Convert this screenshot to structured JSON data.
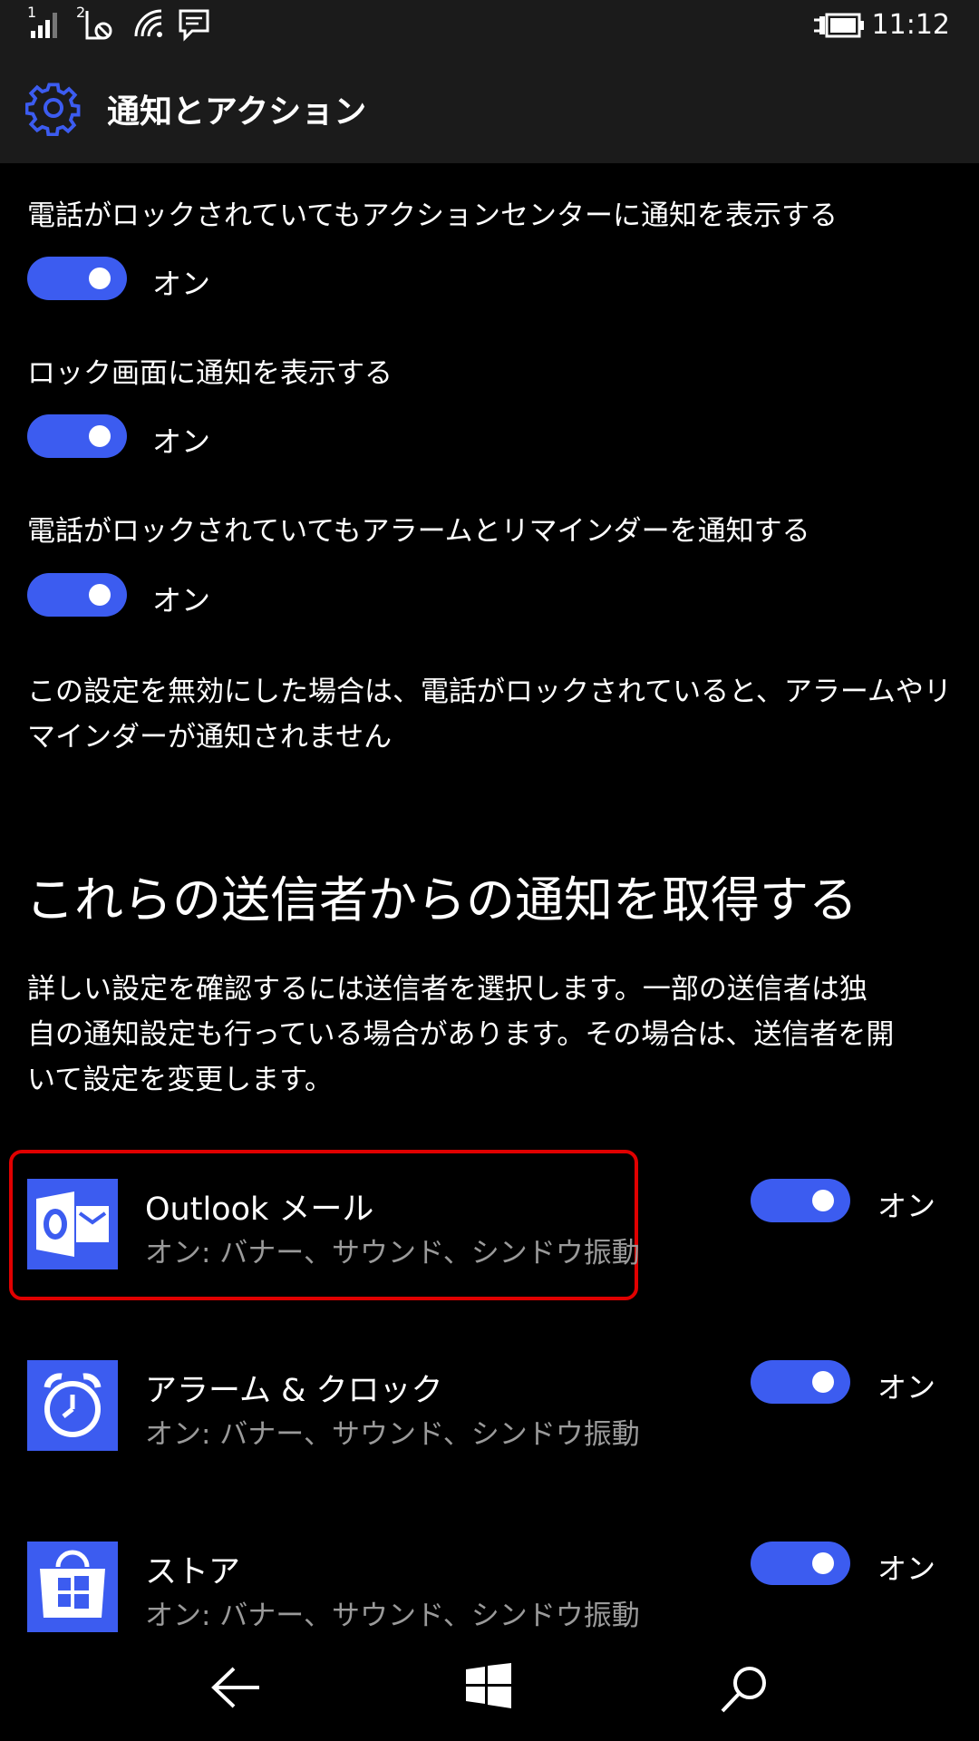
{
  "status_bar": {
    "sim1_label": "1",
    "sim2_label": "2",
    "time": "11:12",
    "icons": [
      "signal-icon",
      "sim2-no-signal-icon",
      "wifi-icon",
      "message-icon",
      "battery-charging-icon"
    ]
  },
  "header": {
    "title": "通知とアクション",
    "icon": "gear-icon"
  },
  "settings": [
    {
      "label": "電話がロックされていてもアクションセンターに通知を表示する",
      "state": "オン"
    },
    {
      "label": "ロック画面に通知を表示する",
      "state": "オン"
    },
    {
      "label": "電話がロックされていてもアラームとリマインダーを通知する",
      "state": "オン"
    }
  ],
  "alarm_note": {
    "line1": "この設定を無効にした場合は、電話がロックされていると、アラームやリ",
    "line2": "マインダーが通知されません"
  },
  "senders": {
    "title": "これらの送信者からの通知を取得する",
    "desc_line1": "詳しい設定を確認するには送信者を選択します。一部の送信者は独",
    "desc_line2": "自の通知設定も行っている場合があります。その場合は、送信者を開",
    "desc_line3": "いて設定を変更します。"
  },
  "apps": [
    {
      "name": "Outlook メール",
      "sub": "オン: バナー、サウンド、シンドウ振動",
      "state": "オン",
      "icon": "outlook-mail-icon",
      "highlighted": true
    },
    {
      "name": "アラーム & クロック",
      "sub": "オン: バナー、サウンド、シンドウ振動",
      "state": "オン",
      "icon": "alarm-clock-icon"
    },
    {
      "name": "ストア",
      "sub": "オン: バナー、サウンド、シンドウ振動",
      "state": "オン",
      "icon": "store-icon"
    }
  ],
  "colors": {
    "accent": "#3c5cf0",
    "header_bg": "#1b1b1b",
    "highlight": "#e00000",
    "subtext": "#9a9a9a"
  },
  "nav": [
    "back-icon",
    "windows-start-icon",
    "search-icon"
  ]
}
